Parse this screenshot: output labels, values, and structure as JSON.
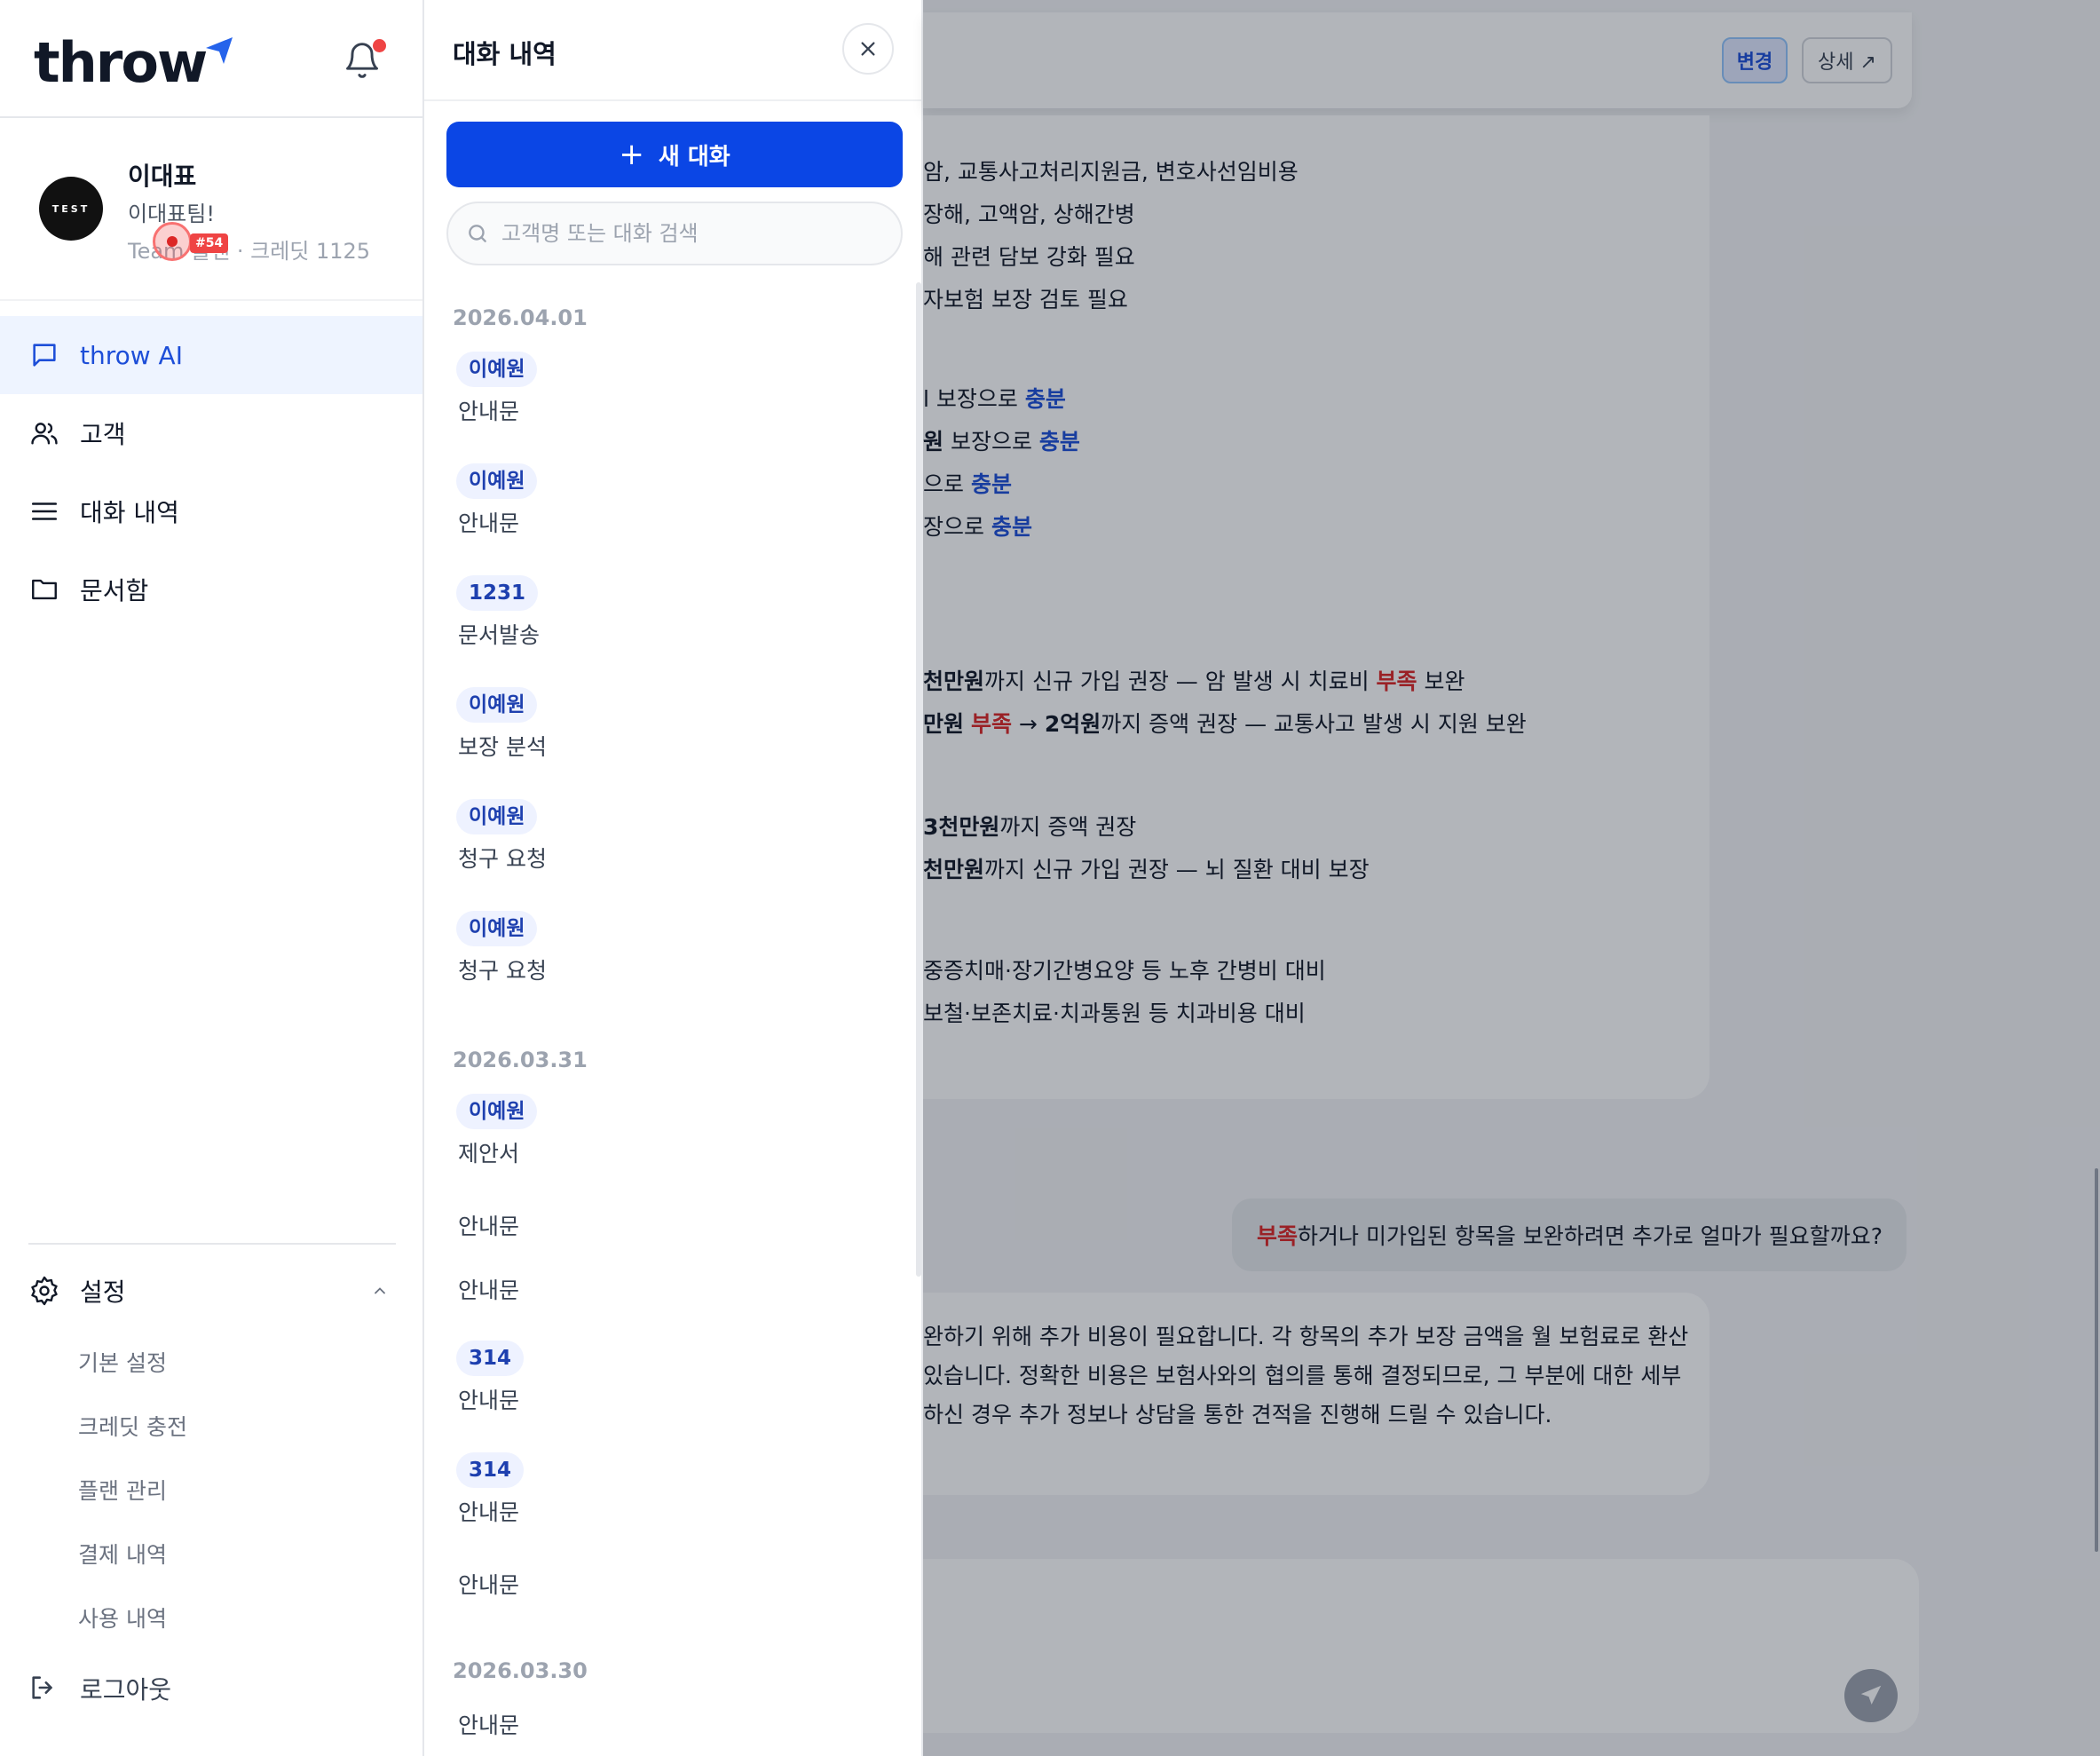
{
  "app": {
    "logo_text": "throw",
    "brand_color": "#0b46e5"
  },
  "sidebar": {
    "profile": {
      "avatar_text": "TEST",
      "name": "이대표",
      "team": "이대표팀!",
      "meta": "Team 플랜 · 크레딧 1125"
    },
    "cursor_badge": "#54",
    "nav": [
      {
        "label": "throw AI",
        "icon": "chat-icon",
        "active": true
      },
      {
        "label": "고객",
        "icon": "users-icon"
      },
      {
        "label": "대화 내역",
        "icon": "list-icon"
      },
      {
        "label": "문서함",
        "icon": "folder-icon"
      }
    ],
    "settings": {
      "label": "설정",
      "items": [
        "기본 설정",
        "크레딧 충전",
        "플랜 관리",
        "결제 내역",
        "사용 내역"
      ]
    },
    "logout_label": "로그아웃"
  },
  "history": {
    "title": "대화 내역",
    "new_chat_label": "새 대화",
    "search_placeholder": "고객명 또는 대화 검색",
    "groups": [
      {
        "date": "2026.04.01",
        "entries": [
          {
            "tag": "이예원",
            "label": "안내문"
          },
          {
            "tag": "이예원",
            "label": "안내문"
          },
          {
            "tag": "1231",
            "label": "문서발송"
          },
          {
            "tag": "이예원",
            "label": "보장 분석"
          },
          {
            "tag": "이예원",
            "label": "청구 요청"
          },
          {
            "tag": "이예원",
            "label": "청구 요청"
          }
        ]
      },
      {
        "date": "2026.03.31",
        "entries": [
          {
            "tag": "이예원",
            "label": "제안서"
          },
          {
            "tag": "",
            "label": "안내문"
          },
          {
            "tag": "",
            "label": "안내문"
          },
          {
            "tag": "314",
            "label": "안내문"
          },
          {
            "tag": "314",
            "label": "안내문"
          },
          {
            "tag": "",
            "label": "안내문"
          }
        ]
      },
      {
        "date": "2026.03.30",
        "entries": [
          {
            "tag": "",
            "label": "안내문"
          }
        ]
      }
    ]
  },
  "main": {
    "topbar": {
      "change_label": "변경",
      "detail_label": "상세 ↗"
    },
    "ai_lines": [
      {
        "t": [
          [
            "암, 교통사고처리지원금, 변호사선임비용",
            ""
          ]
        ]
      },
      {
        "t": [
          [
            "장해, 고액암, 상해간병",
            ""
          ]
        ]
      },
      {
        "t": [
          [
            "해 관련 담보 강화 필요",
            ""
          ]
        ]
      },
      {
        "t": [
          [
            "자보험 보장 검토 필요",
            ""
          ]
        ]
      },
      {
        "t": [
          [
            "l 보장으로 ",
            ""
          ],
          [
            "충분",
            "blue"
          ]
        ]
      },
      {
        "t": [
          [
            "원",
            "b"
          ],
          [
            " 보장으로 ",
            ""
          ],
          [
            "충분",
            "blue"
          ]
        ]
      },
      {
        "t": [
          [
            "으로 ",
            ""
          ],
          [
            "충분",
            "blue"
          ]
        ]
      },
      {
        "t": [
          [
            "장으로 ",
            ""
          ],
          [
            "충분",
            "blue"
          ]
        ]
      },
      {
        "t": [
          [
            "천만원",
            "b"
          ],
          [
            "까지 신규 가입 권장 — 암 발생 시 치료비 ",
            ""
          ],
          [
            "부족",
            "red"
          ],
          [
            " 보완",
            ""
          ]
        ]
      },
      {
        "t": [
          [
            "만원",
            "b"
          ],
          [
            " ",
            ""
          ],
          [
            "부족",
            "red"
          ],
          [
            " → ",
            ""
          ],
          [
            "2억원",
            "b"
          ],
          [
            "까지 증액 권장 — 교통사고 발생 시 지원 보완",
            ""
          ]
        ]
      },
      {
        "t": [
          [
            "3천만원",
            "b"
          ],
          [
            "까지 증액 권장",
            ""
          ]
        ]
      },
      {
        "t": [
          [
            "천만원",
            "b"
          ],
          [
            "까지 신규 가입 권장 — 뇌 질환 대비 보장",
            ""
          ]
        ]
      },
      {
        "t": [
          [
            "중증치매·장기간병요양 등 노후 간병비 대비",
            ""
          ]
        ]
      },
      {
        "t": [
          [
            "보철·보존치료·치과통원 등 치과비용 대비",
            ""
          ]
        ]
      }
    ],
    "user_message": {
      "highlight": "부족",
      "rest": "하거나 미가입된 항목을 보완하려면 추가로 얼마가 필요할까요?"
    },
    "ai_reply": [
      "완하기 위해 추가 비용이 필요합니다. 각 항목의 추가 보장 금액을 월 보험료로 환산",
      " 있습니다. 정확한 비용은 보험사와의 협의를 통해 결정되므로, 그 부분에 대한 세부",
      "하신 경우 추가 정보나 상담을 통한 견적을 진행해 드릴 수 있습니다."
    ]
  }
}
